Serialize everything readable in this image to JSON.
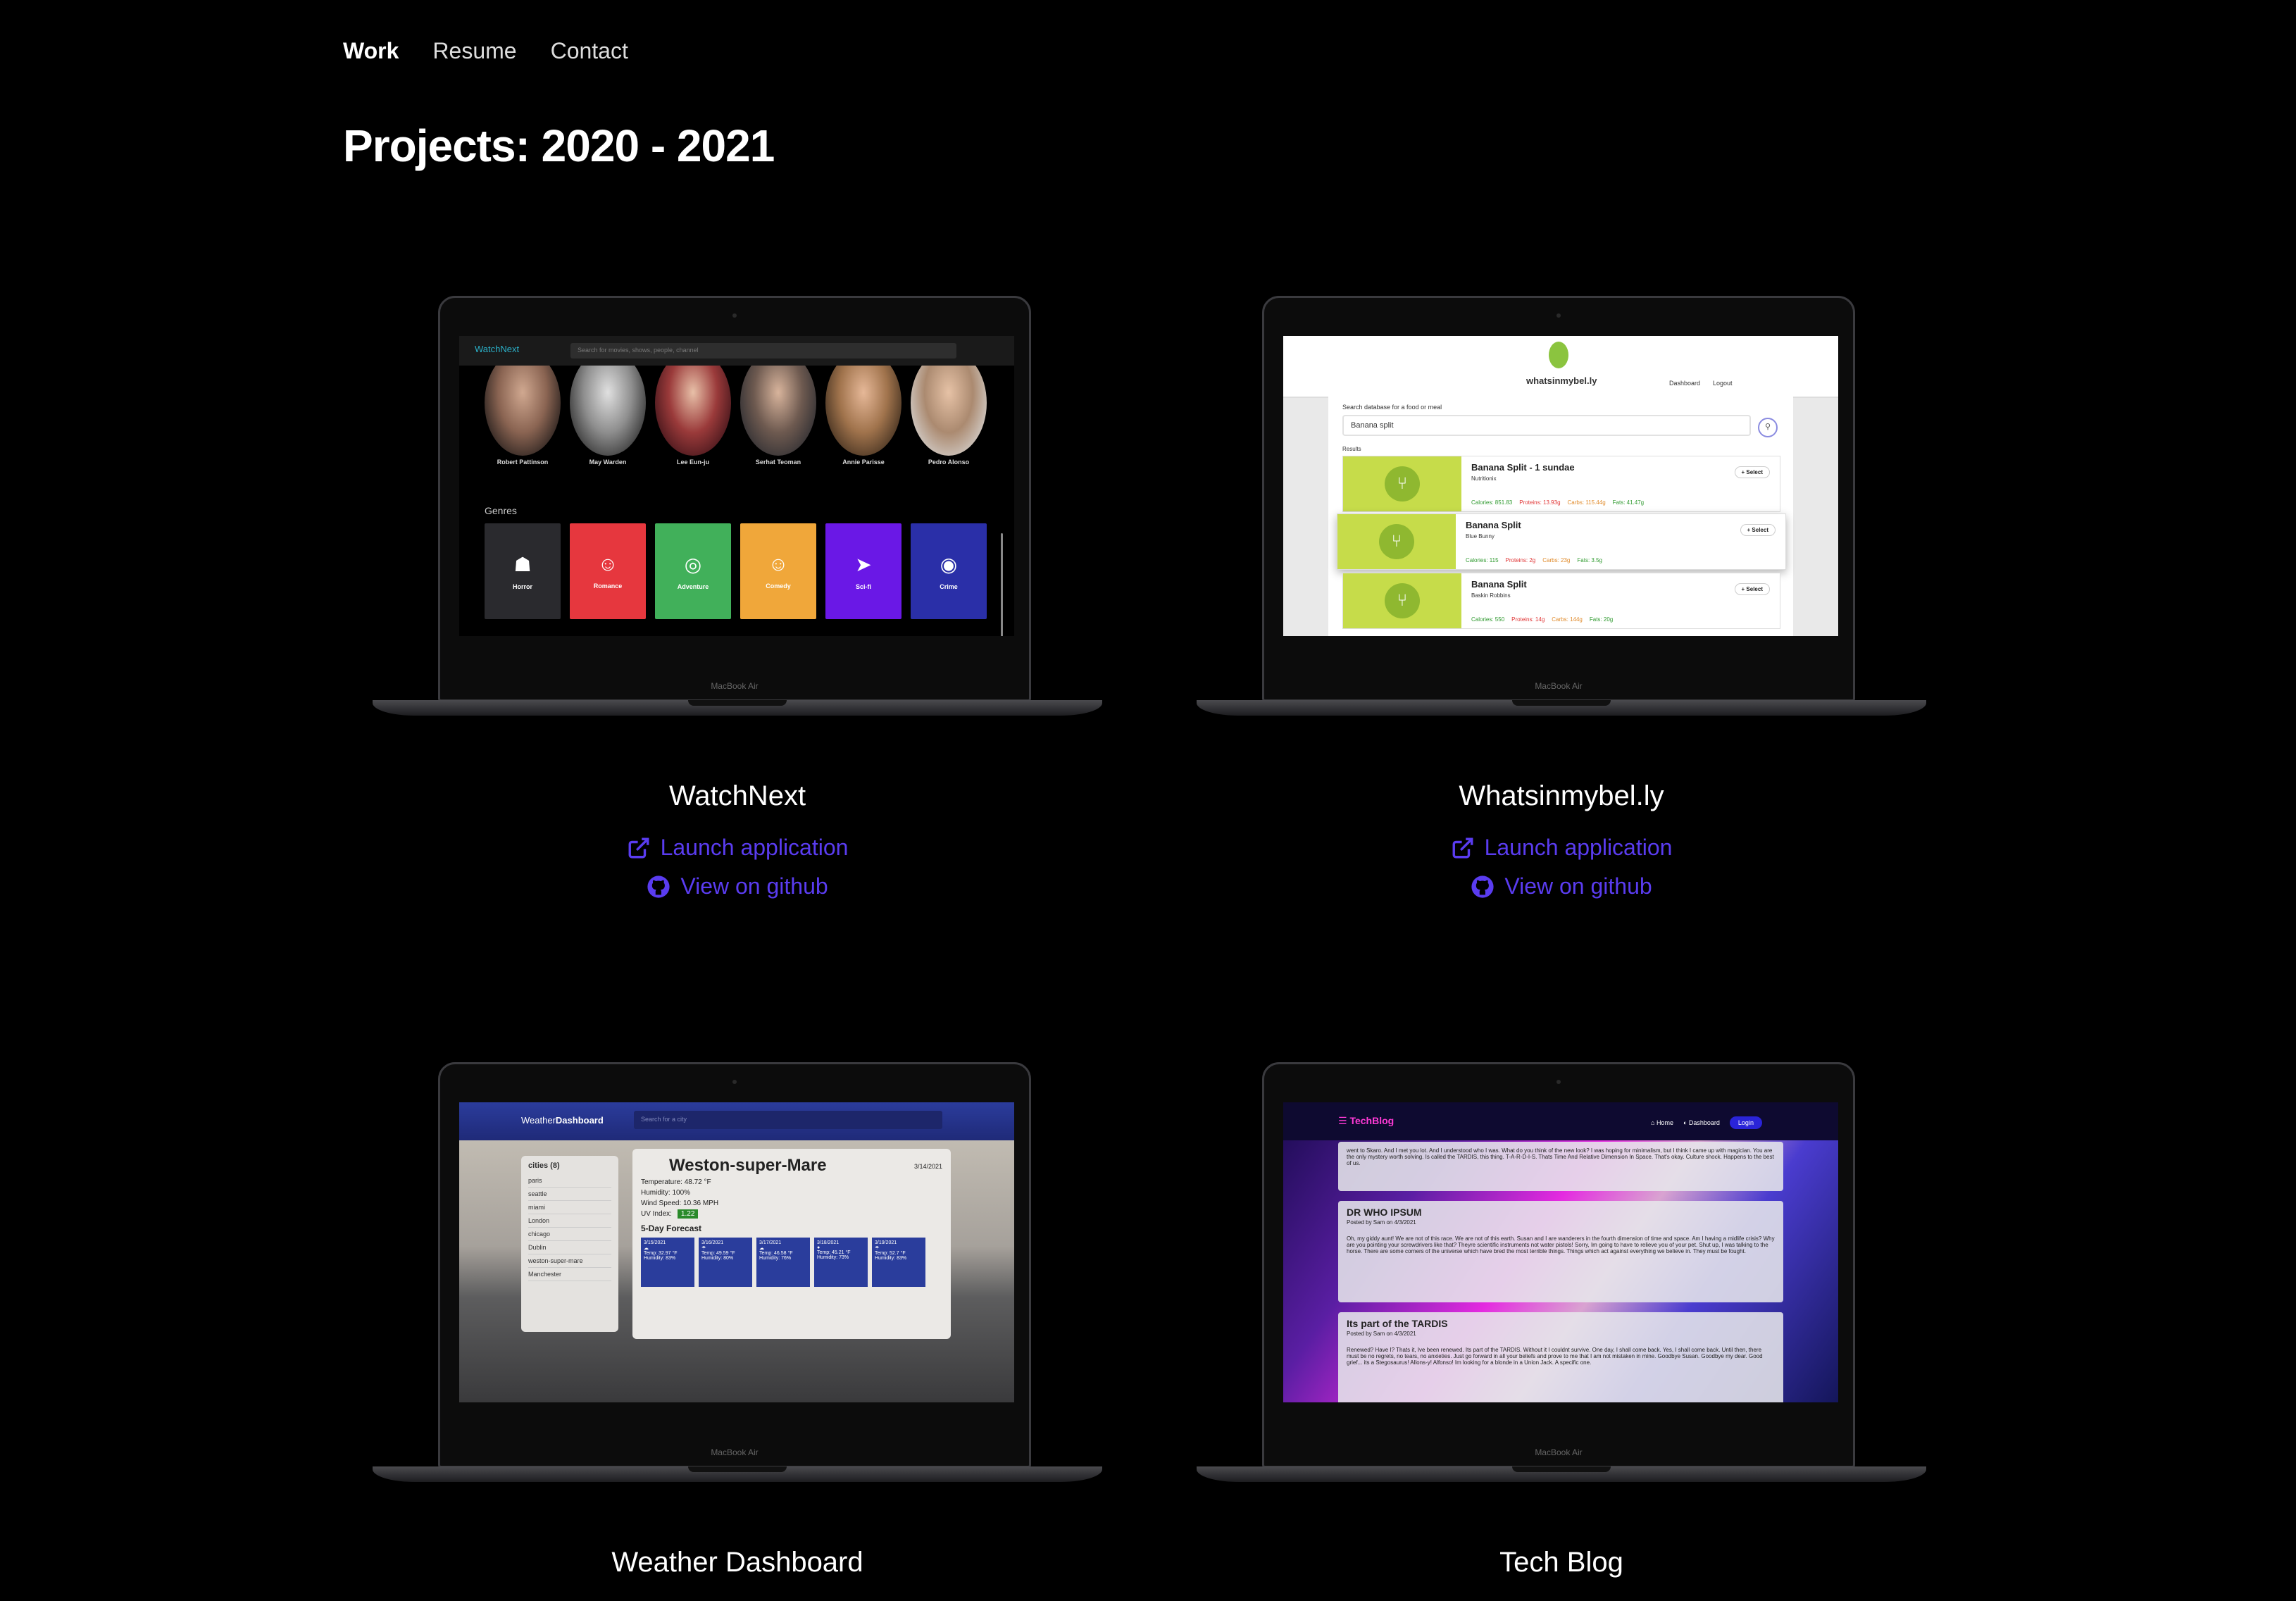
{
  "nav": {
    "items": [
      "Work",
      "Resume",
      "Contact"
    ]
  },
  "page": {
    "title": "Projects: 2020 - 2021"
  },
  "laptop_label": "MacBook Air",
  "colors": {
    "link": "#5a3cf0",
    "background": "#000000"
  },
  "projects": [
    {
      "name": "WatchNext",
      "launch": "Launch application",
      "github": "View on github"
    },
    {
      "name": "Whatsinmybel.ly",
      "launch": "Launch application",
      "github": "View on github"
    },
    {
      "name": "Weather Dashboard"
    },
    {
      "name": "Tech Blog"
    }
  ],
  "watchnext": {
    "logo": "WatchNext",
    "search_placeholder": "Search for movies, shows, people, channel",
    "actors": [
      "Robert Pattinson",
      "May Warden",
      "Lee Eun-ju",
      "Serhat Teoman",
      "Annie Parisse",
      "Pedro Alonso"
    ],
    "genres_heading": "Genres",
    "genres": [
      {
        "name": "Horror",
        "icon": "ghost-icon",
        "glyph": "☗",
        "color": "#2a2a2e"
      },
      {
        "name": "Romance",
        "icon": "heart-eyes-icon",
        "glyph": "☺",
        "color": "#e6373e"
      },
      {
        "name": "Adventure",
        "icon": "compass-icon",
        "glyph": "◎",
        "color": "#41b05a"
      },
      {
        "name": "Comedy",
        "icon": "smile-icon",
        "glyph": "☺",
        "color": "#f0a73a"
      },
      {
        "name": "Sci-fi",
        "icon": "rocket-icon",
        "glyph": "➤",
        "color": "#6a18e6"
      },
      {
        "name": "Crime",
        "icon": "fingerprint-icon",
        "glyph": "◉",
        "color": "#2a2fa8"
      }
    ]
  },
  "whatsinmybelly": {
    "logo": "whatsinmybel.ly",
    "nav": [
      "Dashboard",
      "Logout"
    ],
    "search_label": "Search database for a food or meal",
    "search_value": "Banana split",
    "results_label": "Results",
    "select_label": "+ Select",
    "items": [
      {
        "name": "Banana Split - 1 sundae",
        "brand": "Nutritionix",
        "calories": "Calories: 851.83",
        "proteins": "Proteins: 13.93g",
        "carbs": "Carbs: 115.44g",
        "fats": "Fats: 41.47g"
      },
      {
        "name": "Banana Split",
        "brand": "Blue Bunny",
        "calories": "Calories: 115",
        "proteins": "Proteins: 2g",
        "carbs": "Carbs: 23g",
        "fats": "Fats: 3.5g"
      },
      {
        "name": "Banana Split",
        "brand": "Baskin Robbins",
        "calories": "Calories: 550",
        "proteins": "Proteins: 14g",
        "carbs": "Carbs: 144g",
        "fats": "Fats: 20g"
      }
    ]
  },
  "weather": {
    "logo_prefix": "Weather",
    "logo_bold": "Dashboard",
    "search_placeholder": "Search for a city",
    "cities_heading": "cities (8)",
    "cities": [
      "paris",
      "seattle",
      "miami",
      "London",
      "chicago",
      "Dublin",
      "weston-super-mare",
      "Manchester"
    ],
    "city": "Weston-super-Mare",
    "date": "3/14/2021",
    "temperature": "Temperature: 48.72 °F",
    "humidity": "Humidity: 100%",
    "wind": "Wind Speed: 10.36 MPH",
    "uv_label": "UV Index:",
    "uv_value": "1.22",
    "forecast_heading": "5-Day Forecast",
    "forecast": [
      {
        "date": "3/15/2021",
        "temp": "Temp: 32.97 °F",
        "humidity": "Humidity: 83%"
      },
      {
        "date": "3/16/2021",
        "temp": "Temp: 49.59 °F",
        "humidity": "Humidity: 80%"
      },
      {
        "date": "3/17/2021",
        "temp": "Temp: 46.58 °F",
        "humidity": "Humidity: 76%"
      },
      {
        "date": "3/18/2021",
        "temp": "Temp: 45.21 °F",
        "humidity": "Humidity: 73%"
      },
      {
        "date": "3/19/2021",
        "temp": "Temp: 52.7 °F",
        "humidity": "Humidity: 83%"
      }
    ]
  },
  "techblog": {
    "logo": "TechBlog",
    "nav": [
      "Home",
      "Dashboard",
      "Login"
    ],
    "intro": "went to Skaro. And I met you lot. And I understood who I was. What do you think of the new look? I was hoping for minimalism, but I think I came up with magician. You are the only mystery worth solving. Is called the TARDIS, this thing. T-A-R-D-I-S. Thats Time And Relative Dimension In Space. That's okay. Culture shock. Happens to the best of us.",
    "posts": [
      {
        "title": "DR WHO IPSUM",
        "meta": "Posted by Sam on 4/3/2021",
        "body": "Oh, my giddy aunt! We are not of this race. We are not of this earth. Susan and I are wanderers in the fourth dimension of time and space. Am I having a midlife crisis? Why are you pointing your screwdrivers like that? Theyre scientific instruments not water pistols! Sorry, Im going to have to relieve you of your pet. Shut up, I was talking to the horse. There are some corners of the universe which have bred the most terrible things. Things which act against everything we believe in. They must be fought."
      },
      {
        "title": "Its part of the TARDIS",
        "meta": "Posted by Sam on 4/3/2021",
        "body": "Renewed? Have I? Thats it, Ive been renewed. Its part of the TARDIS. Without it I couldnt survive. One day, I shall come back. Yes, I shall come back. Until then, there must be no regrets, no tears, no anxieties. Just go forward in all your beliefs and prove to me that I am not mistaken in mine. Goodbye Susan. Goodbye my dear. Good grief... its a Stegosaurus! Allons-y! Alfonso! Im looking for a blonde in a Union Jack. A specific one."
      }
    ]
  }
}
